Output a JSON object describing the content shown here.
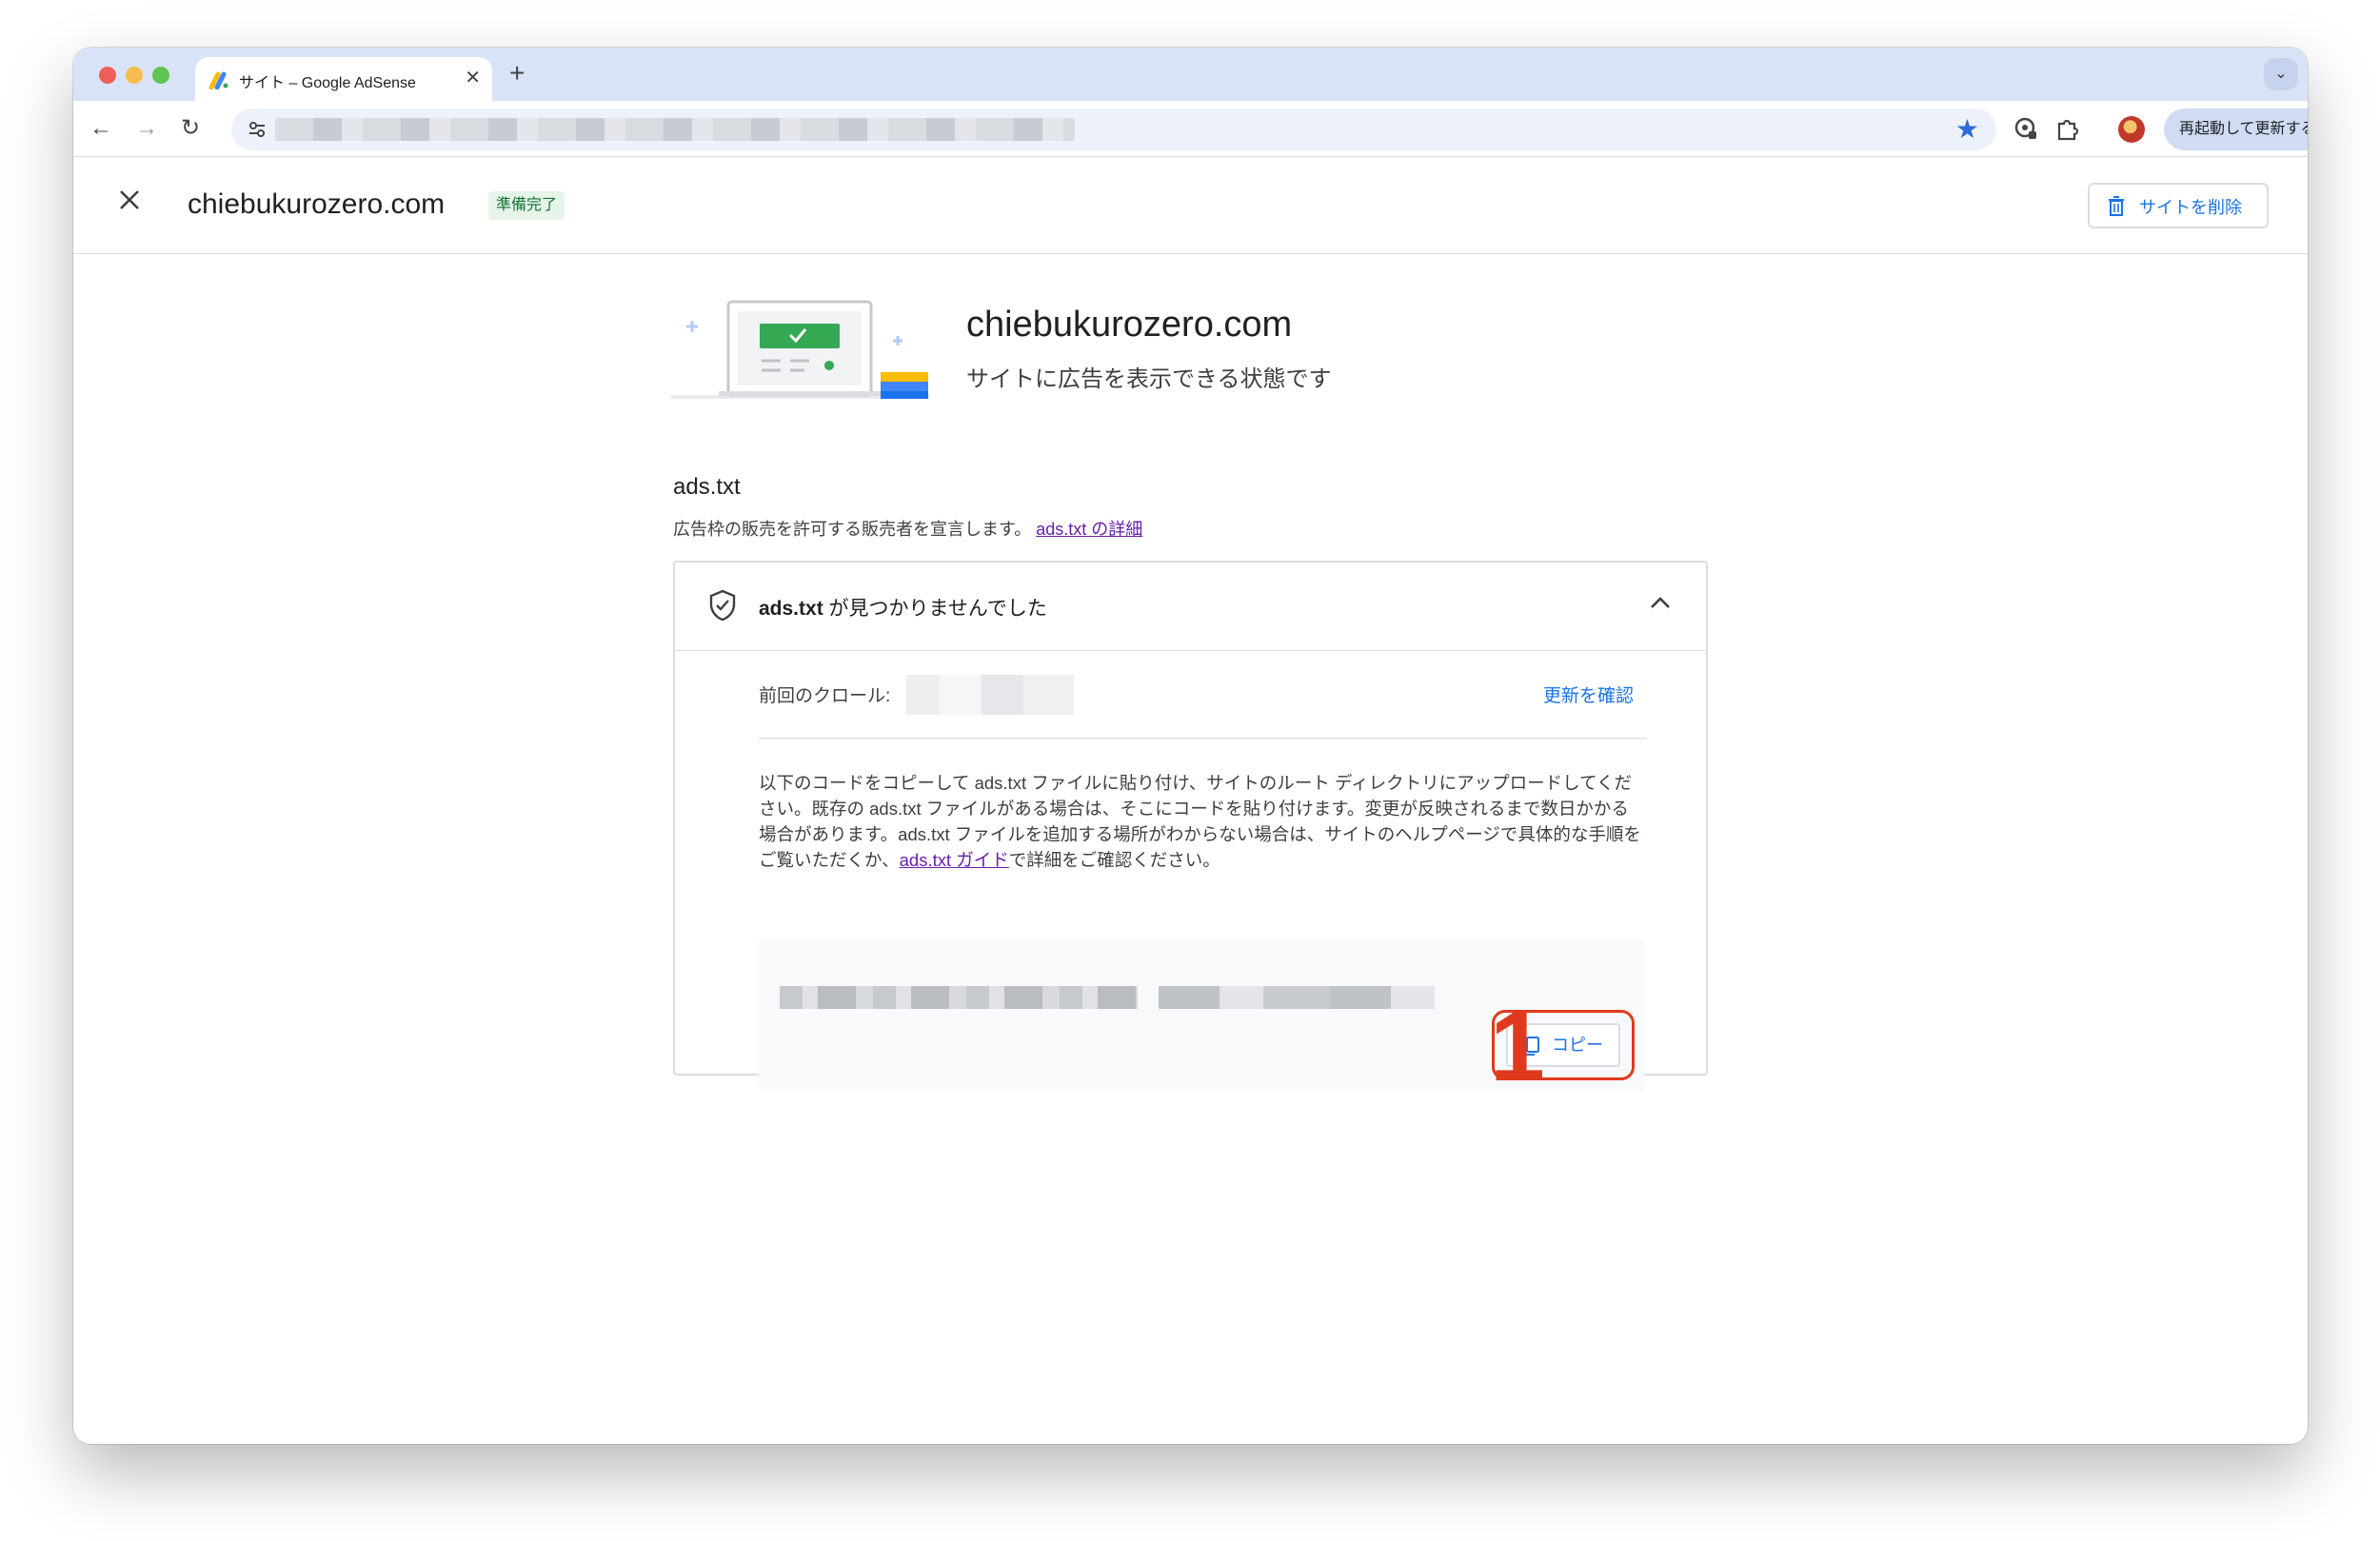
{
  "browser": {
    "tab_title": "サイト – Google AdSense",
    "relaunch_label": "再起動して更新する"
  },
  "header": {
    "site_name": "chiebukurozero.com",
    "status_badge": "準備完了",
    "delete_label": "サイトを削除"
  },
  "hero": {
    "title": "chiebukurozero.com",
    "subtitle": "サイトに広告を表示できる状態です"
  },
  "ads_txt": {
    "section_title": "ads.txt",
    "description": "広告枠の販売を許可する販売者を宣言します。",
    "details_link": "ads.txt の詳細",
    "card_title_code": "ads.txt",
    "card_title_rest": " が見つかりませんでした",
    "last_crawl_label": "前回のクロール:",
    "check_updates_label": "更新を確認",
    "instructions_text": "以下のコードをコピーして ads.txt ファイルに貼り付け、サイトのルート ディレクトリにアップロードしてください。既存の ads.txt ファイルがある場合は、そこにコードを貼り付けます。変更が反映されるまで数日かかる場合があります。ads.txt ファイルを追加する場所がわからない場合は、サイトのヘルプページで具体的な手順をご覧いただくか、",
    "guide_link": "ads.txt ガイド",
    "instructions_tail": "で詳細をご確認ください。",
    "copy_label": "コピー"
  },
  "annotation": {
    "step_number": "1",
    "color": "#e03a1e"
  },
  "colors": {
    "accent_blue": "#1a73e8",
    "badge_green_bg": "#e6f4ea",
    "badge_green_text": "#137333",
    "link_purple": "#681da8"
  }
}
